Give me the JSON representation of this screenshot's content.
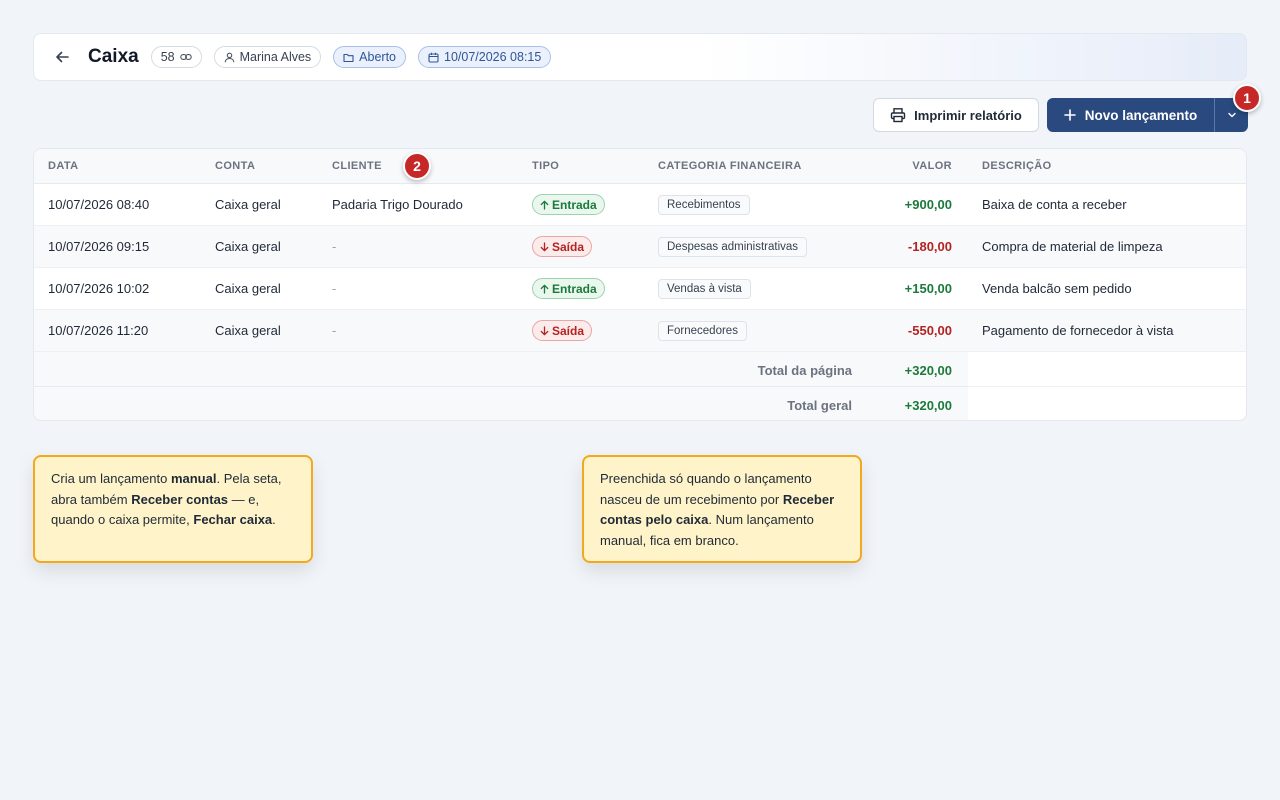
{
  "header": {
    "title": "Caixa",
    "count_badge": "58",
    "user": "Marina Alves",
    "status": "Aberto",
    "opened_at": "10/07/2026 08:15"
  },
  "actions": {
    "print_label": "Imprimir relatório",
    "new_label": "Novo lançamento"
  },
  "markers": [
    "1",
    "2"
  ],
  "table": {
    "columns": [
      "DATA",
      "CONTA",
      "CLIENTE",
      "TIPO",
      "CATEGORIA FINANCEIRA",
      "VALOR",
      "DESCRIÇÃO"
    ],
    "rows": [
      {
        "data": "10/07/2026 08:40",
        "conta": "Caixa geral",
        "cliente": "Padaria Trigo Dourado",
        "tipo": "Entrada",
        "categoria": "Recebimentos",
        "valor": "+900,00",
        "descricao": "Baixa de conta a receber"
      },
      {
        "data": "10/07/2026 09:15",
        "conta": "Caixa geral",
        "cliente": "-",
        "tipo": "Saída",
        "categoria": "Despesas administrativas",
        "valor": "-180,00",
        "descricao": "Compra de material de limpeza"
      },
      {
        "data": "10/07/2026 10:02",
        "conta": "Caixa geral",
        "cliente": "-",
        "tipo": "Entrada",
        "categoria": "Vendas à vista",
        "valor": "+150,00",
        "descricao": "Venda balcão sem pedido"
      },
      {
        "data": "10/07/2026 11:20",
        "conta": "Caixa geral",
        "cliente": "-",
        "tipo": "Saída",
        "categoria": "Fornecedores",
        "valor": "-550,00",
        "descricao": "Pagamento de fornecedor à vista"
      }
    ],
    "total_page_label": "Total da página",
    "total_page_value": "+320,00",
    "total_all_label": "Total geral",
    "total_all_value": "+320,00"
  },
  "callouts": {
    "one": {
      "t1": "Cria um lançamento ",
      "b1": "manual",
      "t2": ". Pela seta, abra também ",
      "b2": "Receber contas",
      "t3": " — e, quando o caixa permite, ",
      "b3": "Fechar caixa",
      "t4": "."
    },
    "two": {
      "t1": "Preenchida só quando o lançamento nasceu de um recebimento por ",
      "b1": "Receber contas pelo caixa",
      "t2": ". Num lançamento manual, fica em branco."
    }
  },
  "colors": {
    "primary": "#29497f",
    "positive": "#1b7a3b",
    "negative": "#b42323",
    "callout_border": "#f2a91e",
    "callout_bg": "#fff4c9",
    "marker": "#c62828"
  }
}
